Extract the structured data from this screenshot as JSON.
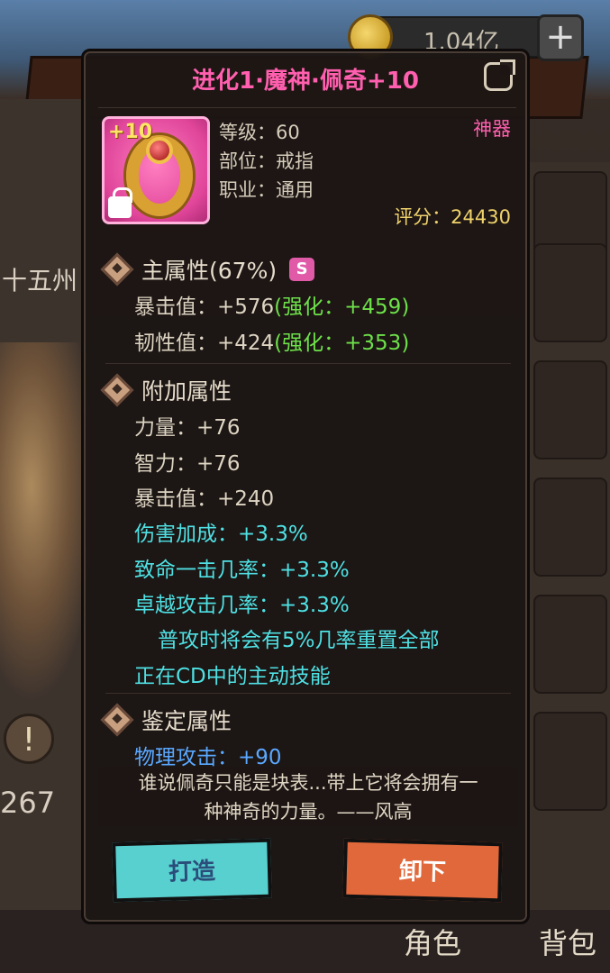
{
  "background": {
    "currency_value": "1.04亿",
    "left_text": "十五州",
    "left_number": "267",
    "tabs": [
      "角色",
      "背包"
    ],
    "right_button_partial": "解"
  },
  "dialog": {
    "title": "进化1·魔神·佩奇+10",
    "item": {
      "enhance_level": "+10",
      "level_line": "等级：60",
      "slot_line": "部位：戒指",
      "class_line": "职业：通用",
      "rarity": "神器",
      "score": "评分：24430"
    },
    "main_attr": {
      "title": "主属性(67%)",
      "grade": "S",
      "stats": [
        {
          "base": "暴击值：+576",
          "bonus": "(强化：+459)"
        },
        {
          "base": "韧性值：+424",
          "bonus": "(强化：+353)"
        }
      ]
    },
    "extra_attr": {
      "title": "附加属性",
      "stats_white": [
        "力量：+76",
        "智力：+76",
        "暴击值：+240"
      ],
      "stats_cyan": [
        "伤害加成：+3.3%",
        "致命一击几率：+3.3%",
        "卓越攻击几率：+3.3%"
      ],
      "skill_line1": "普攻时将会有5%几率重置全部",
      "skill_line2": "正在CD中的主动技能"
    },
    "identify_attr": {
      "title": "鉴定属性",
      "partial_stat": "物理攻击：+90"
    },
    "description_line1": "谁说佩奇只能是块表...带上它将会拥有一",
    "description_line2": "种神奇的力量。——风高",
    "buttons": {
      "forge": "打造",
      "unequip": "卸下"
    }
  }
}
